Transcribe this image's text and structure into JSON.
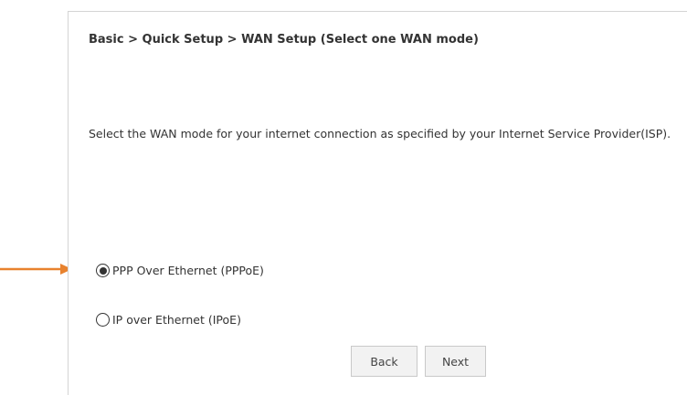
{
  "breadcrumb": "Basic > Quick Setup > WAN Setup (Select one WAN mode)",
  "instruction": "Select the WAN mode for your internet connection as specified by your Internet Service Provider(ISP).",
  "wan_modes": [
    {
      "label": "PPP Over Ethernet (PPPoE)",
      "selected": true
    },
    {
      "label": "IP over Ethernet (IPoE)",
      "selected": false
    }
  ],
  "buttons": {
    "back_label": "Back",
    "next_label": "Next"
  },
  "colors": {
    "annotation_arrow": "#e8822e",
    "text": "#333333",
    "button_bg": "#f2f2f2",
    "button_border": "#c9c9c9"
  }
}
